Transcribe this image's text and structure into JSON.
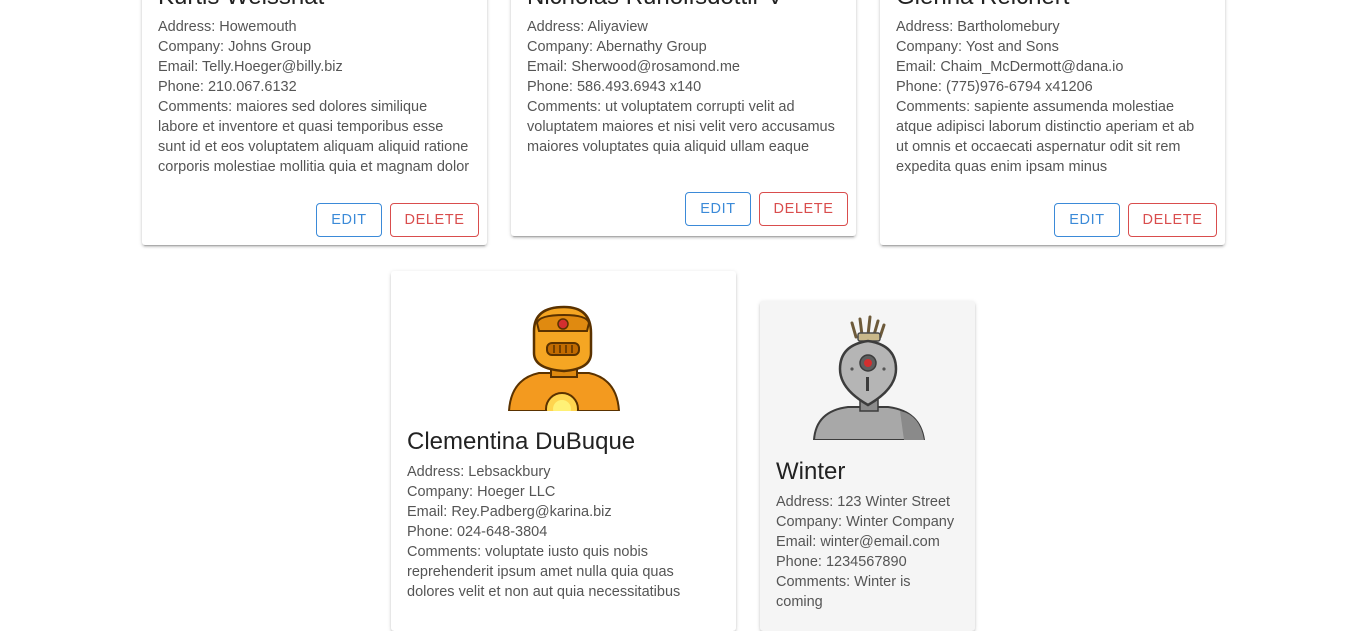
{
  "cards": [
    {
      "name": "Kurtis Weissnat",
      "address": "Address: Howemouth",
      "company": "Company: Johns Group",
      "email": "Email: Telly.Hoeger@billy.biz",
      "phone": "Phone: 210.067.6132",
      "comments": "Comments: maiores sed dolores similique labore et inventore et quasi temporibus esse sunt id et eos voluptatem aliquam aliquid ratione corporis molestiae mollitia quia et magnam dolor",
      "edit_label": "EDIT",
      "delete_label": "DELETE"
    },
    {
      "name": "Nicholas Runolfsdottir V",
      "address": "Address: Aliyaview",
      "company": "Company: Abernathy Group",
      "email": "Email: Sherwood@rosamond.me",
      "phone": "Phone: 586.493.6943 x140",
      "comments": "Comments: ut voluptatem corrupti velit ad voluptatem maiores et nisi velit vero accusamus maiores voluptates quia aliquid ullam eaque",
      "edit_label": "EDIT",
      "delete_label": "DELETE"
    },
    {
      "name": "Glenna Reichert",
      "address": "Address: Bartholomebury",
      "company": "Company: Yost and Sons",
      "email": "Email: Chaim_McDermott@dana.io",
      "phone": "Phone: (775)976-6794 x41206",
      "comments": "Comments: sapiente assumenda molestiae atque adipisci laborum distinctio aperiam et ab ut omnis et occaecati aspernatur odit sit rem expedita quas enim ipsam minus",
      "edit_label": "EDIT",
      "delete_label": "DELETE"
    },
    {
      "name": "Clementina DuBuque",
      "address": "Address: Lebsackbury",
      "company": "Company: Hoeger LLC",
      "email": "Email: Rey.Padberg@karina.biz",
      "phone": "Phone: 024-648-3804",
      "comments": "Comments: voluptate iusto quis nobis reprehenderit ipsum amet nulla quia quas dolores velit et non aut quia necessitatibus"
    },
    {
      "name": "Winter",
      "address": "Address: 123 Winter Street",
      "company": "Company: Winter Company",
      "email": "Email: winter@email.com",
      "phone": "Phone: 1234567890",
      "comments": "Comments: Winter is coming"
    }
  ],
  "icons": {
    "orange_robot": "robot-avatar-orange",
    "gray_robot": "robot-avatar-gray"
  },
  "colors": {
    "edit": "#1976d2",
    "delete": "#d32f2f",
    "robot_orange": "#f5a623",
    "robot_gray": "#9e9e9e"
  }
}
